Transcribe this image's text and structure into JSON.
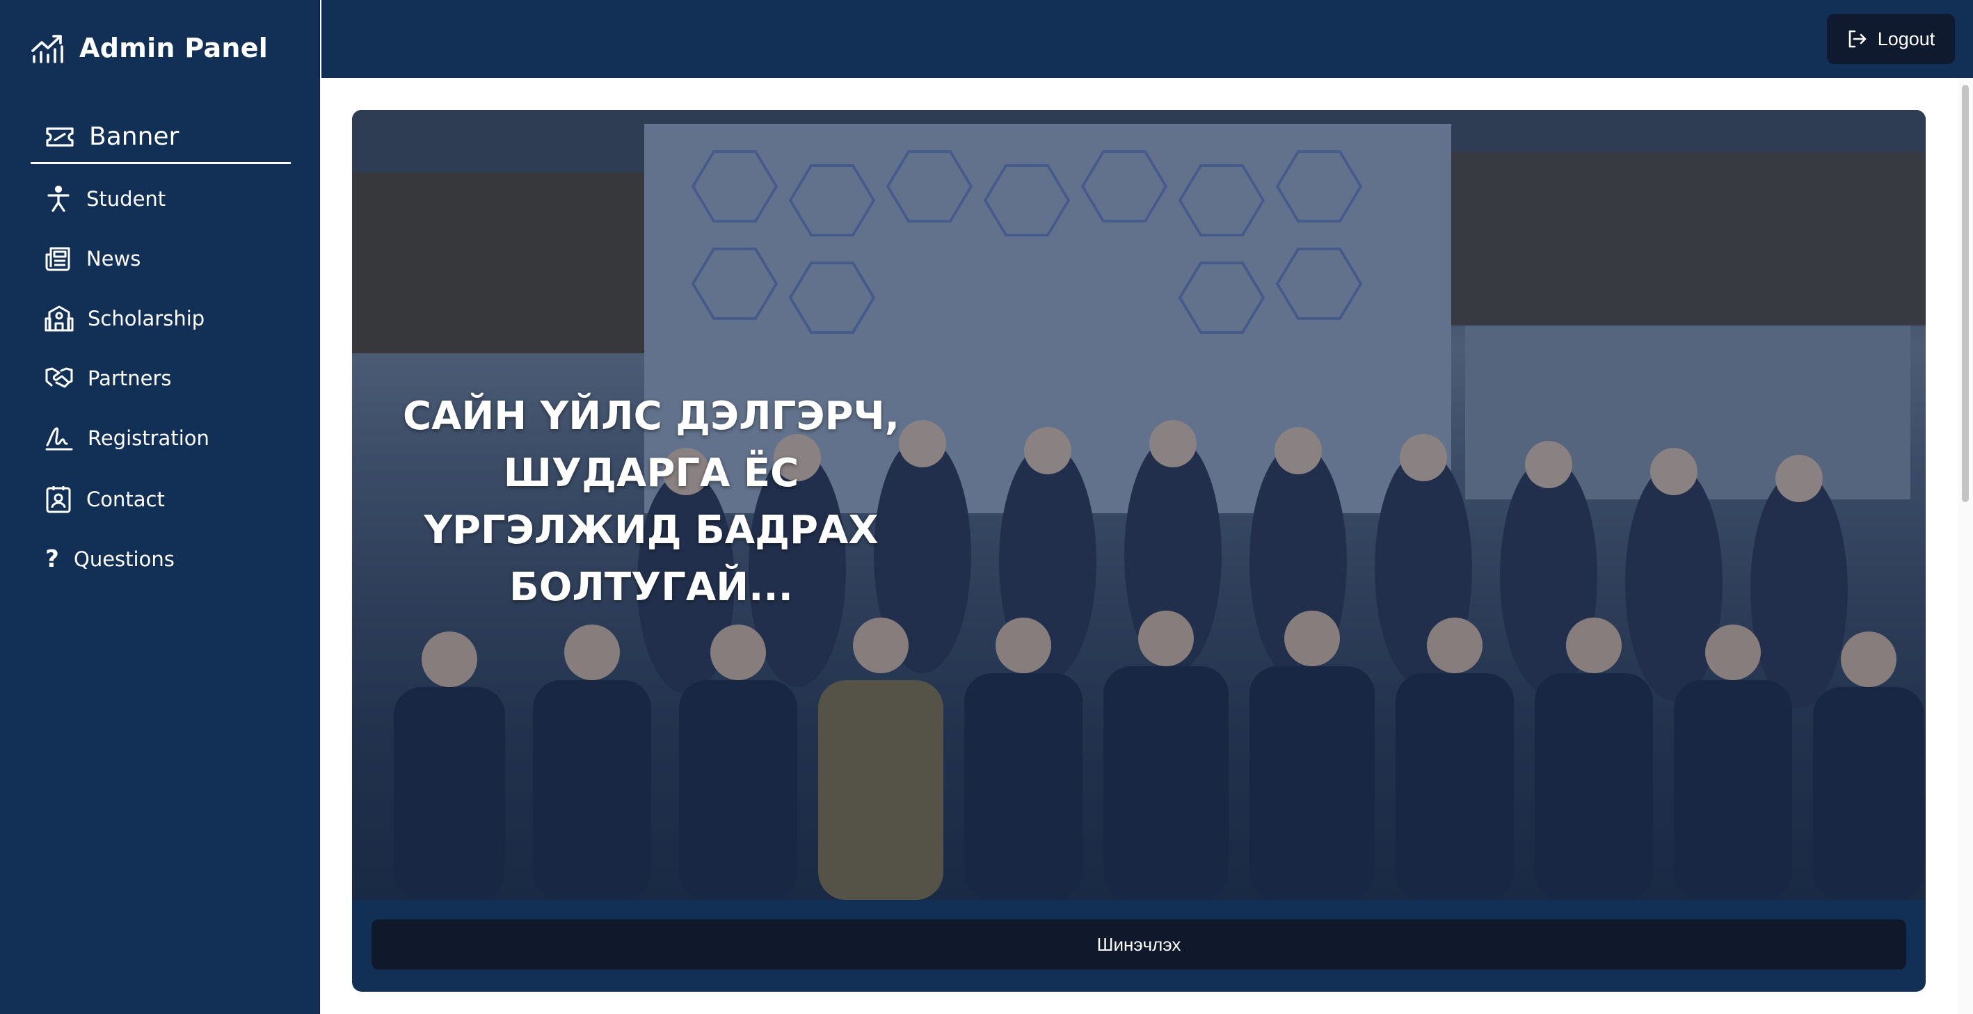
{
  "brand": {
    "title": "Admin Panel",
    "icon": "chart-growth-icon"
  },
  "sidebar": {
    "active": {
      "label": "Banner",
      "icon": "ticket-icon"
    },
    "items": [
      {
        "label": "Student",
        "icon": "person-icon"
      },
      {
        "label": "News",
        "icon": "newspaper-icon"
      },
      {
        "label": "Scholarship",
        "icon": "school-icon"
      },
      {
        "label": "Partners",
        "icon": "handshake-icon"
      },
      {
        "label": "Registration",
        "icon": "signature-icon"
      },
      {
        "label": "Contact",
        "icon": "contact-card-icon"
      },
      {
        "label": "Questions",
        "icon": "question-icon"
      }
    ]
  },
  "header": {
    "logout_label": "Logout",
    "logout_icon": "logout-icon"
  },
  "banner": {
    "lines": [
      "САЙН ҮЙЛС ДЭЛГЭРЧ,",
      "ШУДАРГА ЁС",
      "ҮРГЭЛЖИД БАДРАХ",
      "БОЛТУГАЙ..."
    ],
    "update_label": "Шинэчлэх"
  },
  "colors": {
    "sidebar": "#123056",
    "button_dark": "#10182b",
    "text": "#ffffff"
  }
}
